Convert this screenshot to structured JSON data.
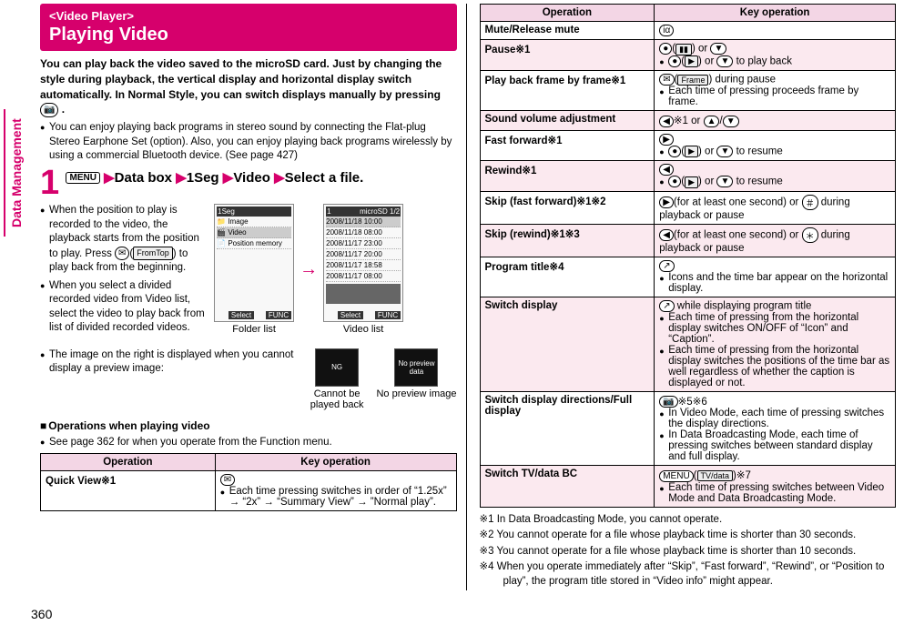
{
  "sidetab": "Data Management",
  "pageNumber": "360",
  "banner": {
    "sub": "<Video Player>",
    "title": "Playing Video"
  },
  "lead": "You can play back the video saved to the microSD card. Just by changing the style during playback, the vertical display and horizontal display switch automatically. In Normal Style, you can switch displays manually by pressing ",
  "lead_key": "📷",
  "lead_end": ".",
  "bullet1": "You can enjoy playing back programs in stereo sound by connecting the Flat-plug Stereo Earphone Set (option). Also, you can enjoy playing back programs wirelessly by using a commercial Bluetooth device. (See page 427)",
  "step1": {
    "num": "1",
    "menu": "MENU",
    "parts": [
      "Data box",
      "1Seg",
      "Video",
      "Select a file."
    ]
  },
  "step_bullets": {
    "b1a": "When the position to play is recorded to the video, the playback starts from the position to play. Press ",
    "b1b": " to play back from the beginning.",
    "b1key_icon": "✉",
    "b1key_lbl": "FromTop",
    "b2": "When you select a divided recorded video from Video list, select the video to play back from list of divided recorded videos."
  },
  "folder_shot": {
    "title": "1Seg",
    "lines": [
      "Image",
      "Video",
      "Position memory"
    ],
    "bottom_center": "Select",
    "bottom_right": "FUNC"
  },
  "video_shot": {
    "title_left": "1",
    "title_right": "microSD    1/2",
    "lines": [
      "2008/11/18 10:00",
      "2008/11/18 08:00",
      "2008/11/17 23:00",
      "2008/11/17 20:00",
      "2008/11/17 18:58",
      "2008/11/17 08:00"
    ],
    "bottom_center": "Select",
    "bottom_right": "FUNC"
  },
  "caption_folder": "Folder list",
  "caption_video": "Video list",
  "preview_note": "The image on the right is displayed when you cannot display a preview image:",
  "thumbs": {
    "ng": "NG",
    "ng_cap1": "Cannot be",
    "ng_cap2": "played back",
    "nopv": "No preview data",
    "nopv_cap": "No preview image"
  },
  "ops_heading": "Operations when playing video",
  "ops_note": "See page 362 for when you operate from the Function menu.",
  "table_headers": {
    "op": "Operation",
    "key": "Key operation"
  },
  "table_left": {
    "r1op": "Quick View※1",
    "r1k_icon": "✉",
    "r1k_txt": "Each time pressing switches in order of “1.25x” → “2x” → “Summary View” → ”Normal play”."
  },
  "table_right": [
    {
      "alt": false,
      "op": "Mute/Release mute",
      "key_html": "<span class=\"kicon kicon-round\" data-name=\"key-icon\" data-interactable=\"false\">iα</span>"
    },
    {
      "alt": true,
      "op": "Pause※1",
      "key_html": "<span class=\"kicon kicon-round\">●</span>(<span class=\"keybox\">▮▮</span>) or <span class=\"kicon kicon-round\">▼</span><div class=\"opbul\"><span class=\"kicon kicon-round\">●</span>(<span class=\"keybox\">▶</span>) or <span class=\"kicon kicon-round\">▼</span> to play back</div>"
    },
    {
      "alt": false,
      "op": "Play back frame by frame※1",
      "key_html": "<span class=\"kicon kicon-round\">✉</span>(<span class=\"keybox\">Frame</span>) during pause<div class=\"opbul\">Each time of pressing proceeds frame by frame.</div>"
    },
    {
      "alt": true,
      "op": "Sound volume adjustment",
      "key_html": "<span class=\"kicon kicon-round\">◀</span>※1 or <span class=\"kicon kicon-round\">▲</span>/<span class=\"kicon kicon-round\">▼</span>"
    },
    {
      "alt": false,
      "op": "Fast forward※1",
      "key_html": "<span class=\"kicon kicon-round\">▶</span><div class=\"opbul\"><span class=\"kicon kicon-round\">●</span>(<span class=\"keybox\">▶</span>) or <span class=\"kicon kicon-round\">▼</span> to resume</div>"
    },
    {
      "alt": true,
      "op": "Rewind※1",
      "key_html": "<span class=\"kicon kicon-round\">◀</span><div class=\"opbul\"><span class=\"kicon kicon-round\">●</span>(<span class=\"keybox\">▶</span>) or <span class=\"kicon kicon-round\">▼</span> to resume</div>"
    },
    {
      "alt": false,
      "op": "Skip (fast forward)※1※2",
      "key_html": "<span class=\"kicon kicon-round\">▶</span>(for at least one second) or <span class=\"kicon kicon-round\">＃</span> during playback or pause"
    },
    {
      "alt": true,
      "op": "Skip (rewind)※1※3",
      "key_html": "<span class=\"kicon kicon-round\">◀</span>(for at least one second) or <span class=\"kicon kicon-round\">＊</span> during playback or pause"
    },
    {
      "alt": false,
      "op": "Program title※4",
      "key_html": "<span class=\"kicon kicon-round\">↗</span><div class=\"opbul\">Icons and the time bar appear on the horizontal display.</div>"
    },
    {
      "alt": true,
      "op": "Switch display",
      "key_html": "<span class=\"kicon kicon-round\">↗</span> while displaying program title<div class=\"opbul\">Each time of pressing from the horizontal display switches ON/OFF of “Icon” and “Caption”.</div><div class=\"opbul\">Each time of pressing from the horizontal display switches the positions of the time bar as well regardless of whether the caption is displayed or not.</div>"
    },
    {
      "alt": false,
      "op": "Switch display directions/Full display",
      "key_html": "<span class=\"kicon kicon-round\">📷</span>※5※6<div class=\"opbul\">In Video Mode, each time of pressing switches the display directions.</div><div class=\"opbul\">In Data Broadcasting Mode, each time of pressing switches between standard display and full display.</div>"
    },
    {
      "alt": true,
      "op": "Switch TV/data BC",
      "key_html": "<span class=\"kicon kicon-round\">MENU</span>(<span class=\"keybox\">TV/data</span>)※7<div class=\"opbul\">Each time of pressing switches between Video Mode and Data Broadcasting Mode.</div>"
    }
  ],
  "notes": {
    "n1": "※1 In Data Broadcasting Mode, you cannot operate.",
    "n2": "※2 You cannot operate for a file whose playback time is shorter than 30 seconds.",
    "n3": "※3 You cannot operate for a file whose playback time is shorter than 10 seconds.",
    "n4": "※4 When you operate immediately after “Skip”, “Fast forward”, “Rewind”, or “Position to play”, the program title stored in “Video info” might appear."
  }
}
